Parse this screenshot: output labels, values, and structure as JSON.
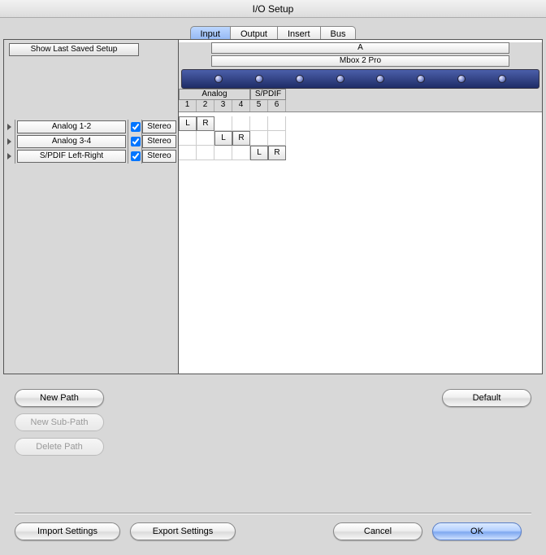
{
  "window": {
    "title": "I/O Setup"
  },
  "tabs": {
    "input": "Input",
    "output": "Output",
    "insert": "Insert",
    "bus": "Bus",
    "active": "input"
  },
  "left": {
    "show_last": "Show Last Saved Setup"
  },
  "device": {
    "slot": "A",
    "name": "Mbox 2 Pro",
    "groups": {
      "analog": "Analog",
      "spdif": "S/PDIF"
    },
    "channels": [
      "1",
      "2",
      "3",
      "4",
      "5",
      "6"
    ]
  },
  "paths": [
    {
      "name": "Analog 1-2",
      "enabled": true,
      "format": "Stereo",
      "assign": {
        "L": 0,
        "R": 1
      }
    },
    {
      "name": "Analog 3-4",
      "enabled": true,
      "format": "Stereo",
      "assign": {
        "L": 2,
        "R": 3
      }
    },
    {
      "name": "S/PDIF Left-Right",
      "enabled": true,
      "format": "Stereo",
      "assign": {
        "L": 4,
        "R": 5
      }
    }
  ],
  "buttons": {
    "new_path": "New Path",
    "new_sub_path": "New Sub-Path",
    "delete_path": "Delete Path",
    "default": "Default",
    "import": "Import Settings",
    "export": "Export Settings",
    "cancel": "Cancel",
    "ok": "OK"
  }
}
